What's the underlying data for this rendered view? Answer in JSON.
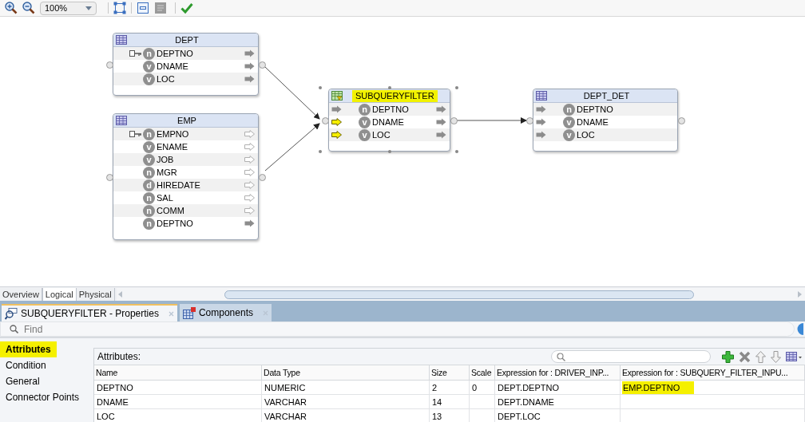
{
  "toolbar": {
    "zoom": "100%"
  },
  "nodes": [
    {
      "title": "DEPT",
      "kind": "table",
      "highlighted": false,
      "attributes": [
        {
          "name": "DEPTNO",
          "type": "n",
          "key": true,
          "input_port": false,
          "input_highlighted": false,
          "output_port": true,
          "output_connected": true
        },
        {
          "name": "DNAME",
          "type": "v",
          "key": false,
          "input_port": false,
          "input_highlighted": false,
          "output_port": true,
          "output_connected": true
        },
        {
          "name": "LOC",
          "type": "v",
          "key": false,
          "input_port": false,
          "input_highlighted": false,
          "output_port": true,
          "output_connected": true
        }
      ]
    },
    {
      "title": "EMP",
      "kind": "table",
      "highlighted": false,
      "attributes": [
        {
          "name": "EMPNO",
          "type": "n",
          "key": true,
          "input_port": false,
          "input_highlighted": false,
          "output_port": true,
          "output_connected": false
        },
        {
          "name": "ENAME",
          "type": "v",
          "key": false,
          "input_port": false,
          "input_highlighted": false,
          "output_port": true,
          "output_connected": false
        },
        {
          "name": "JOB",
          "type": "v",
          "key": false,
          "input_port": false,
          "input_highlighted": false,
          "output_port": true,
          "output_connected": false
        },
        {
          "name": "MGR",
          "type": "n",
          "key": false,
          "input_port": false,
          "input_highlighted": false,
          "output_port": true,
          "output_connected": false
        },
        {
          "name": "HIREDATE",
          "type": "d",
          "key": false,
          "input_port": false,
          "input_highlighted": false,
          "output_port": true,
          "output_connected": false
        },
        {
          "name": "SAL",
          "type": "n",
          "key": false,
          "input_port": false,
          "input_highlighted": false,
          "output_port": true,
          "output_connected": false
        },
        {
          "name": "COMM",
          "type": "n",
          "key": false,
          "input_port": false,
          "input_highlighted": false,
          "output_port": true,
          "output_connected": false
        },
        {
          "name": "DEPTNO",
          "type": "n",
          "key": false,
          "input_port": false,
          "input_highlighted": false,
          "output_port": true,
          "output_connected": true
        }
      ]
    },
    {
      "title": "SUBQUERYFILTER",
      "kind": "filter",
      "highlighted": true,
      "attributes": [
        {
          "name": "DEPTNO",
          "type": "n",
          "key": false,
          "input_port": true,
          "input_highlighted": false,
          "output_port": true,
          "output_connected": true
        },
        {
          "name": "DNAME",
          "type": "v",
          "key": false,
          "input_port": true,
          "input_highlighted": true,
          "output_port": true,
          "output_connected": true
        },
        {
          "name": "LOC",
          "type": "v",
          "key": false,
          "input_port": true,
          "input_highlighted": true,
          "output_port": true,
          "output_connected": true
        }
      ]
    },
    {
      "title": "DEPT_DET",
      "kind": "table",
      "highlighted": false,
      "attributes": [
        {
          "name": "DEPTNO",
          "type": "n",
          "key": false,
          "input_port": true,
          "input_highlighted": false,
          "output_port": false,
          "output_connected": false
        },
        {
          "name": "DNAME",
          "type": "v",
          "key": false,
          "input_port": true,
          "input_highlighted": false,
          "output_port": false,
          "output_connected": false
        },
        {
          "name": "LOC",
          "type": "v",
          "key": false,
          "input_port": true,
          "input_highlighted": false,
          "output_port": false,
          "output_connected": false
        }
      ]
    }
  ],
  "view_tabs": [
    {
      "label": "Overview",
      "selected": false
    },
    {
      "label": "Logical",
      "selected": true
    },
    {
      "label": "Physical",
      "selected": false
    }
  ],
  "panel_tabs": [
    {
      "label": "SUBQUERYFILTER - Properties",
      "kind": "properties",
      "selected": true
    },
    {
      "label": "Components",
      "kind": "components",
      "selected": false
    }
  ],
  "find": {
    "placeholder": "Find"
  },
  "sections": [
    {
      "label": "Attributes",
      "selected": true,
      "highlighted": true
    },
    {
      "label": "Condition",
      "selected": false,
      "highlighted": false
    },
    {
      "label": "General",
      "selected": false,
      "highlighted": false
    },
    {
      "label": "Connector Points",
      "selected": false,
      "highlighted": false
    }
  ],
  "attributes_table": {
    "label": "Attributes:",
    "columns": [
      "Name",
      "Data Type",
      "Size",
      "Scale",
      "Expression for : DRIVER_INP...",
      "Expression for : SUBQUERY_FILTER_INPU..."
    ],
    "rows": [
      [
        {
          "text": "DEPTNO",
          "highlighted": false
        },
        {
          "text": "NUMERIC",
          "highlighted": false
        },
        {
          "text": "2",
          "highlighted": false
        },
        {
          "text": "0",
          "highlighted": false
        },
        {
          "text": "DEPT.DEPTNO",
          "highlighted": false
        },
        {
          "text": "EMP.DEPTNO",
          "highlighted": true
        }
      ],
      [
        {
          "text": "DNAME",
          "highlighted": false
        },
        {
          "text": "VARCHAR",
          "highlighted": false
        },
        {
          "text": "14",
          "highlighted": false
        },
        null,
        {
          "text": "DEPT.DNAME",
          "highlighted": false
        },
        null
      ],
      [
        {
          "text": "LOC",
          "highlighted": false
        },
        {
          "text": "VARCHAR",
          "highlighted": false
        },
        {
          "text": "13",
          "highlighted": false
        },
        null,
        {
          "text": "DEPT.LOC",
          "highlighted": false
        },
        null
      ]
    ]
  }
}
